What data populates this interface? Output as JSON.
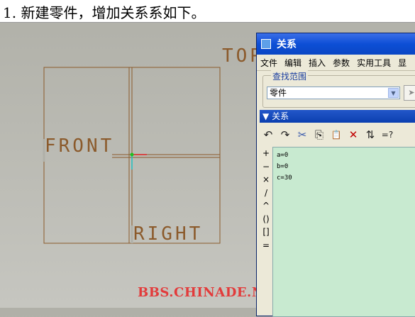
{
  "caption": "1. 新建零件，增加关系系如下。",
  "planes": {
    "top": "TOP",
    "front": "FRONT",
    "right": "RIGHT"
  },
  "watermark": "BBS.CHINADE.NET",
  "dialog": {
    "title": "关系",
    "menu": [
      "文件",
      "编辑",
      "插入",
      "参数",
      "实用工具",
      "显"
    ],
    "lookup_label": "查找范围",
    "lookup_value": "零件",
    "relations_header": "关系",
    "toolbar_icons": [
      "undo-icon",
      "redo-icon",
      "cut-icon",
      "copy-icon",
      "paste-icon",
      "delete-icon",
      "sort-icon",
      "evaluate-icon"
    ],
    "toolbar_glyphs": [
      "↶",
      "↷",
      "✂",
      "⎘",
      "📋",
      "✕",
      "⇅",
      "=?"
    ],
    "operators": [
      "+",
      "−",
      "×",
      "/",
      "^",
      "()",
      "[]",
      "="
    ],
    "relations": [
      "a=0",
      "b=0",
      "c=30"
    ]
  },
  "colors": {
    "datum": "#8b5a2b",
    "title_bar": "#0d4fd6",
    "editor_bg": "#c8ead0",
    "watermark": "#e23b3b"
  }
}
